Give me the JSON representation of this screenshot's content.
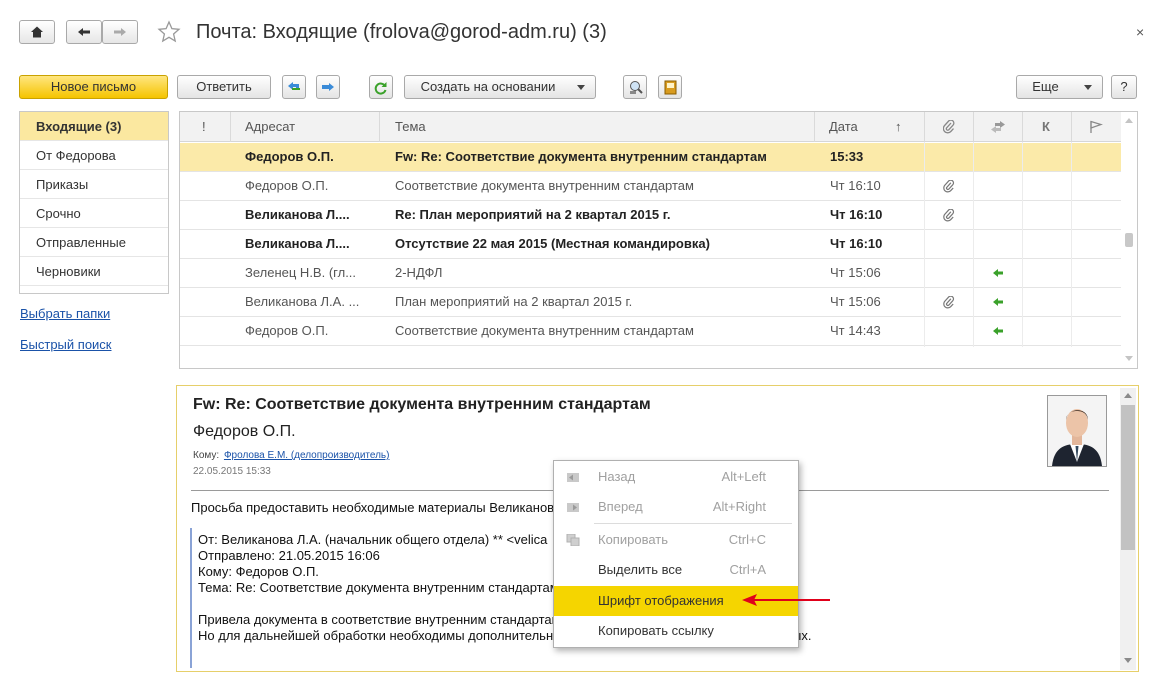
{
  "window": {
    "title": "Почта: Входящие (frolova@gorod-adm.ru) (3)",
    "close": "×"
  },
  "toolbar": {
    "new_mail": "Новое письмо",
    "reply": "Ответить",
    "create_based_on": "Создать на основании",
    "more": "Еще",
    "help": "?"
  },
  "sidebar": {
    "folders": [
      {
        "label": "Входящие (3)",
        "active": true
      },
      {
        "label": "От Федорова"
      },
      {
        "label": "Приказы"
      },
      {
        "label": "Срочно"
      },
      {
        "label": "Отправленные"
      },
      {
        "label": "Черновики"
      }
    ],
    "choose_folders": "Выбрать папки",
    "quick_search": "Быстрый поиск"
  },
  "table": {
    "columns": {
      "importance": "!",
      "addressee": "Адресат",
      "subject": "Тема",
      "date": "Дата",
      "sort": "↑",
      "attach": "attach",
      "flag_fwd": "fwd",
      "k": "К",
      "flag": "flag"
    },
    "rows": [
      {
        "addressee": "Федоров О.П.",
        "subject": "Fw: Re: Соответствие документа внутренним стандартам",
        "date": "15:33",
        "bold": true,
        "selected": true,
        "attach": false,
        "fwd": false
      },
      {
        "addressee": "Федоров О.П.",
        "subject": "Соответствие документа внутренним стандартам",
        "date": "Чт 16:10",
        "bold": false,
        "attach": true,
        "fwd": false
      },
      {
        "addressee": "Великанова Л....",
        "subject": "Re: План мероприятий на 2 квартал 2015 г.",
        "date": "Чт 16:10",
        "bold": true,
        "attach": true,
        "fwd": false
      },
      {
        "addressee": "Великанова Л....",
        "subject": "Отсутствие 22 мая 2015 (Местная командировка)",
        "date": "Чт 16:10",
        "bold": true,
        "attach": false,
        "fwd": false
      },
      {
        "addressee": "Зеленец Н.В. (гл...",
        "subject": "2-НДФЛ",
        "date": "Чт 15:06",
        "bold": false,
        "attach": false,
        "fwd": true
      },
      {
        "addressee": "Великанова Л.А. ...",
        "subject": "План мероприятий на 2 квартал 2015 г.",
        "date": "Чт 15:06",
        "bold": false,
        "attach": true,
        "fwd": true
      },
      {
        "addressee": "Федоров О.П.",
        "subject": "Соответствие документа внутренним стандартам",
        "date": "Чт 14:43",
        "bold": false,
        "attach": false,
        "fwd": true
      }
    ]
  },
  "preview": {
    "subject": "Fw: Re: Соответствие документа внутренним стандартам",
    "sender": "Федоров О.П.",
    "to_label": "Кому:",
    "to_value": "Фролова Е.М. (делопроизводитель)",
    "date": "22.05.2015 15:33",
    "body_intro": "Просьба предоставить необходимые материалы Великановой",
    "quote": [
      "От: Великанова Л.А. (начальник общего отдела)  ** <velica",
      "Отправлено: 21.05.2015 16:06",
      "Кому: Федоров О.П.",
      "Тема: Re: Соответствие документа внутренним стандартам"
    ],
    "quote_body1": "Привела документа в соответствие внутренним стандартам",
    "quote_body2": "Но для дальнейшей обработки необходимы дополнительн",
    "quote_body2_tail": "ых."
  },
  "context_menu": {
    "items": [
      {
        "label": "Назад",
        "shortcut": "Alt+Left",
        "disabled": true
      },
      {
        "label": "Вперед",
        "shortcut": "Alt+Right",
        "disabled": true
      },
      {
        "label": "Копировать",
        "shortcut": "Ctrl+C",
        "disabled": true
      },
      {
        "label": "Выделить все",
        "shortcut": "Ctrl+A",
        "disabled": false
      },
      {
        "label": "Шрифт отображения",
        "shortcut": "",
        "highlighted": true
      },
      {
        "label": "Копировать ссылку",
        "shortcut": ""
      }
    ]
  },
  "colors": {
    "accent_yellow": "#f5c400",
    "selection": "#fbeaa9",
    "menu_highlight": "#f5d500",
    "link": "#1a52a8",
    "arrow_red": "#e0001a",
    "green_arrow": "#3aa12a"
  }
}
